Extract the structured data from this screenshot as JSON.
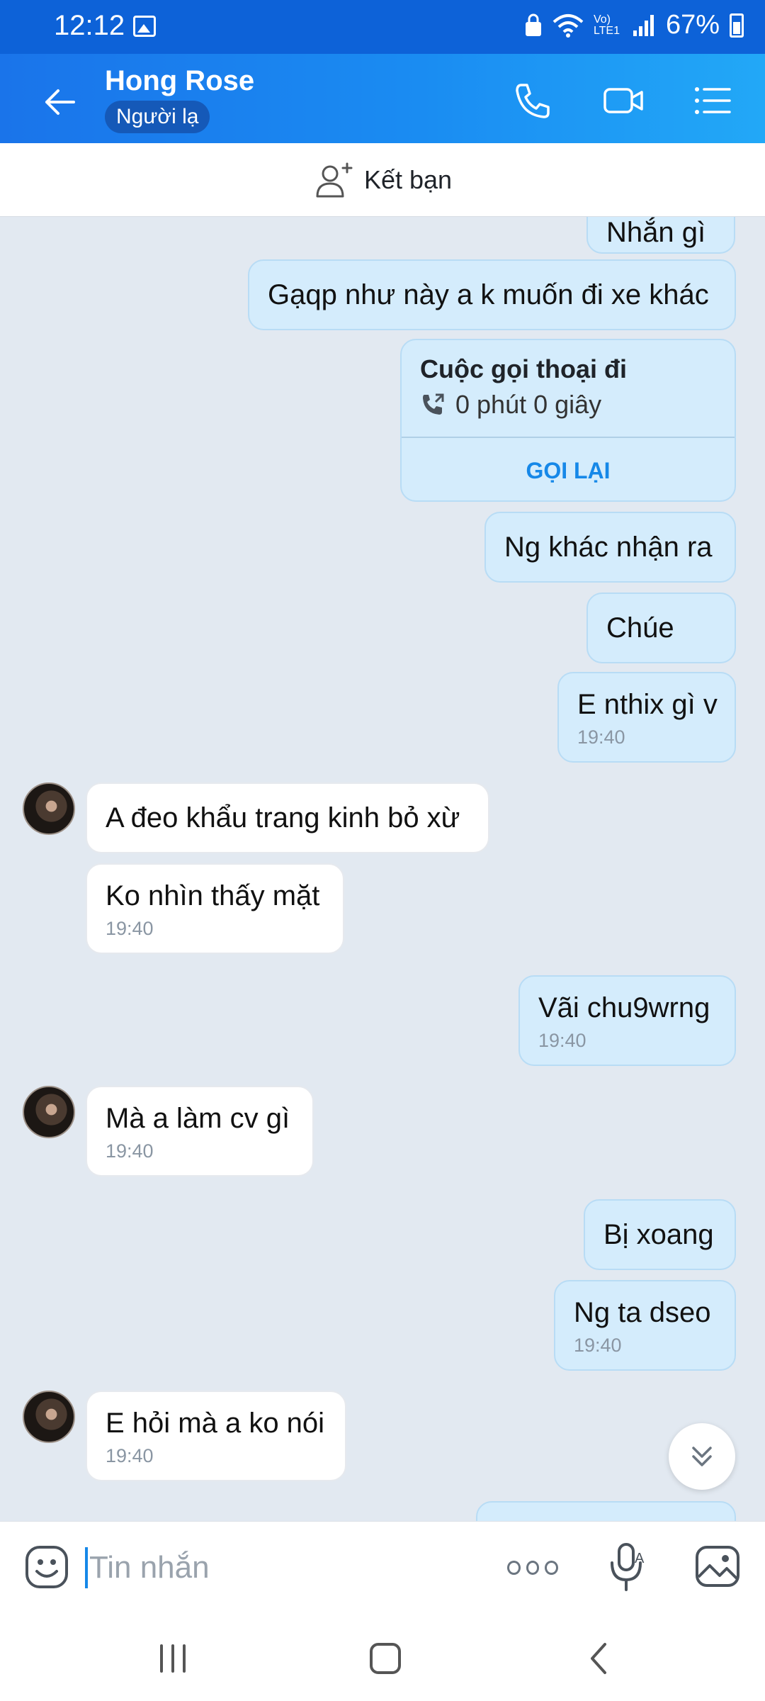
{
  "status_bar": {
    "time": "12:12",
    "battery": "67%",
    "network": "Vo) LTE1"
  },
  "header": {
    "title": "Hong Rose",
    "badge": "Người lạ"
  },
  "add_friend": {
    "label": "Kết bạn"
  },
  "chat": {
    "partial_top_text": "Nhắn gì",
    "messages": [
      {
        "dir": "out",
        "text": "Gạqp như này a k muốn đi xe khác"
      },
      {
        "dir": "out",
        "text": "Ng khác nhận ra"
      },
      {
        "dir": "out",
        "text": "Chúe"
      },
      {
        "dir": "out",
        "text": "E nthix gì v",
        "time": "19:40"
      },
      {
        "dir": "in",
        "text": "A đeo khẩu trang kinh bỏ xừ"
      },
      {
        "dir": "in",
        "text": "Ko nhìn thấy mặt",
        "time": "19:40"
      },
      {
        "dir": "out",
        "text": "Vãi chu9wrng",
        "time": "19:40"
      },
      {
        "dir": "in",
        "text": "Mà a làm cv gì",
        "time": "19:40"
      },
      {
        "dir": "out",
        "text": "Bị xoang"
      },
      {
        "dir": "out",
        "text": "Ng ta dseo",
        "time": "19:40"
      },
      {
        "dir": "in",
        "text": "E hỏi mà a ko nói",
        "time": "19:40"
      }
    ],
    "call_card": {
      "title": "Cuộc gọi thoại đi",
      "duration": "0 phút 0 giây",
      "action": "GỌI LẠI"
    }
  },
  "input": {
    "placeholder": "Tin nhắn"
  },
  "colors": {
    "header_start": "#1a74ea",
    "header_end": "#22a8f7",
    "out_bubble": "#d4ecfc",
    "in_bubble": "#ffffff",
    "chat_bg": "#e2e9f1",
    "accent": "#1688e8"
  },
  "icons": [
    "arrow-left-icon",
    "phone-icon",
    "video-icon",
    "list-icon",
    "add-person-icon",
    "phone-outgoing-icon",
    "chevron-double-down-icon",
    "emoji-icon",
    "more-icon",
    "mic-icon",
    "gallery-icon"
  ]
}
